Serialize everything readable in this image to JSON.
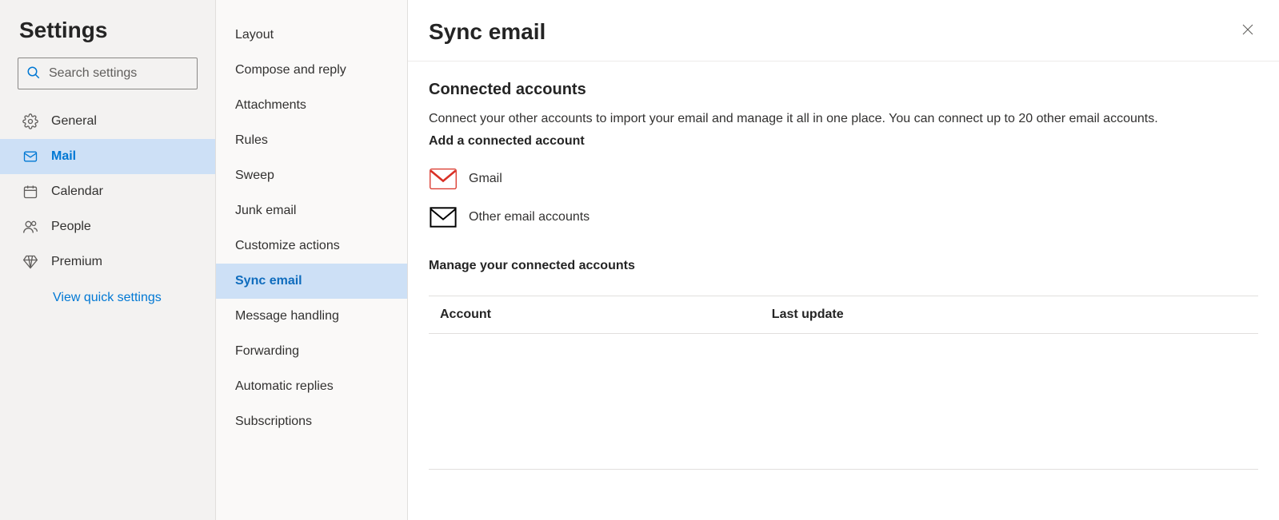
{
  "sidebar": {
    "title": "Settings",
    "search_placeholder": "Search settings",
    "items": [
      {
        "id": "general",
        "label": "General"
      },
      {
        "id": "mail",
        "label": "Mail"
      },
      {
        "id": "calendar",
        "label": "Calendar"
      },
      {
        "id": "people",
        "label": "People"
      },
      {
        "id": "premium",
        "label": "Premium"
      }
    ],
    "quick_settings": "View quick settings"
  },
  "subnav": {
    "items": [
      "Layout",
      "Compose and reply",
      "Attachments",
      "Rules",
      "Sweep",
      "Junk email",
      "Customize actions",
      "Sync email",
      "Message handling",
      "Forwarding",
      "Automatic replies",
      "Subscriptions"
    ],
    "active_index": 7
  },
  "content": {
    "title": "Sync email",
    "section1_heading": "Connected accounts",
    "section1_desc": "Connect your other accounts to import your email and manage it all in one place. You can connect up to 20 other email accounts.",
    "add_heading": "Add a connected account",
    "option_gmail": "Gmail",
    "option_other": "Other email accounts",
    "manage_heading": "Manage your connected accounts",
    "table": {
      "col_account": "Account",
      "col_last_update": "Last update"
    }
  }
}
